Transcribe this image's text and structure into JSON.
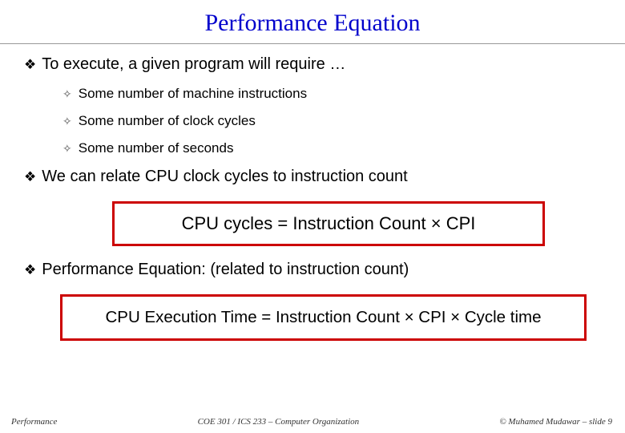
{
  "title": "Performance Equation",
  "bullets": {
    "b1": "To execute, a given program will require …",
    "b1_subs": {
      "s1": "Some number of machine instructions",
      "s2": "Some number of clock cycles",
      "s3": "Some number of seconds"
    },
    "b2": "We can relate CPU clock cycles to instruction count",
    "b3": "Performance Equation: (related to instruction count)"
  },
  "formulas": {
    "f1": "CPU cycles  =  Instruction Count × CPI",
    "f2": "CPU Execution Time  =  Instruction Count × CPI × Cycle time"
  },
  "footer": {
    "left": "Performance",
    "center": "COE 301 / ICS 233 – Computer Organization",
    "right": "© Muhamed Mudawar – slide 9"
  },
  "glyphs": {
    "diamond": "❖",
    "cross": "✧"
  }
}
